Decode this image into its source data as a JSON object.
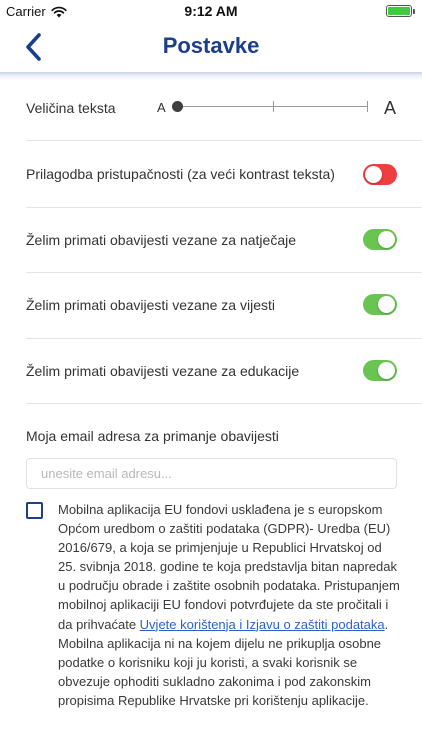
{
  "status_bar": {
    "carrier": "Carrier",
    "time": "9:12 AM",
    "battery_color": "#3ecb3e"
  },
  "nav": {
    "back_icon": "chevron-left-icon",
    "title": "Postavke",
    "title_color": "#1b3f8b"
  },
  "settings": {
    "text_size": {
      "label": "Veličina teksta",
      "small_glyph": "A",
      "large_glyph": "A",
      "steps": 3,
      "selected_step": 0
    },
    "toggles": [
      {
        "label": "Prilagodba pristupačnosti (za veći kontrast teksta)",
        "on": false
      },
      {
        "label": "Želim primati obavijesti vezane za natječaje",
        "on": true
      },
      {
        "label": "Želim primati obavijesti vezane za vijesti",
        "on": true
      },
      {
        "label": "Želim primati obavijesti vezane za edukacije",
        "on": true
      }
    ],
    "toggle_colors": {
      "on": "#6ac452",
      "off": "#ef3e3e"
    }
  },
  "email": {
    "label": "Moja email adresa za primanje obavijesti",
    "placeholder": "unesite email adresu...",
    "value": ""
  },
  "consent": {
    "checked": false,
    "text_part1": "Mobilna aplikacija EU fondovi usklađena je s europskom Općom uredbom o zaštiti podataka (GDPR)- Uredba (EU) 2016/679, a koja se primjenjuje u Republici Hrvatskoj od 25. svibnja 2018. godine te koja predstavlja bitan napredak u području obrade i zaštite osobnih podataka. Pristupanjem mobilnoj aplikaciji EU fondovi potvrđujete da ste pročitali i da prihvaćate ",
    "link_text": "Uvjete korištenja i Izjavu o zaštiti podataka",
    "text_part2": ". Mobilna aplikacija ni na kojem dijelu ne prikuplja osobne podatke o korisniku koji ju koristi, a svaki korisnik se obvezuje ophoditi sukladno zakonima i pod zakonskim propisima Republike Hrvatske pri korištenju aplikacije."
  }
}
